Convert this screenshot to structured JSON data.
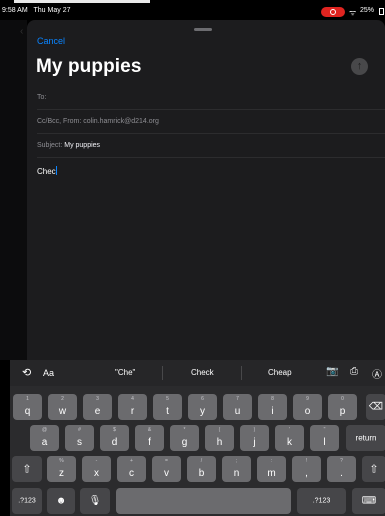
{
  "status": {
    "time": "9:58 AM",
    "date": "Thu May 27",
    "battery": "25%"
  },
  "compose": {
    "cancel_label": "Cancel",
    "title": "My puppies",
    "to_label": "To:",
    "ccbcc_label": "Cc/Bcc, From:",
    "from_value": "colin.hamrick@d214.org",
    "subject_label": "Subject:",
    "subject_value": "My puppies",
    "body_text": "Chec"
  },
  "suggestions": {
    "format_label": "Aa",
    "items": [
      "\"Che\"",
      "Check",
      "Cheap"
    ]
  },
  "keyboard": {
    "row1": [
      {
        "main": "q",
        "hint": "1"
      },
      {
        "main": "w",
        "hint": "2"
      },
      {
        "main": "e",
        "hint": "3"
      },
      {
        "main": "r",
        "hint": "4"
      },
      {
        "main": "t",
        "hint": "5"
      },
      {
        "main": "y",
        "hint": "6"
      },
      {
        "main": "u",
        "hint": "7"
      },
      {
        "main": "i",
        "hint": "8"
      },
      {
        "main": "o",
        "hint": "9"
      },
      {
        "main": "p",
        "hint": "0"
      }
    ],
    "row2": [
      {
        "main": "a",
        "hint": "@"
      },
      {
        "main": "s",
        "hint": "#"
      },
      {
        "main": "d",
        "hint": "$"
      },
      {
        "main": "f",
        "hint": "&"
      },
      {
        "main": "g",
        "hint": "*"
      },
      {
        "main": "h",
        "hint": "("
      },
      {
        "main": "j",
        "hint": ")"
      },
      {
        "main": "k",
        "hint": "'"
      },
      {
        "main": "l",
        "hint": "\""
      }
    ],
    "row3": [
      {
        "main": "z",
        "hint": "%"
      },
      {
        "main": "x",
        "hint": "-"
      },
      {
        "main": "c",
        "hint": "+"
      },
      {
        "main": "v",
        "hint": "="
      },
      {
        "main": "b",
        "hint": "/"
      },
      {
        "main": "n",
        "hint": ";"
      },
      {
        "main": "m",
        "hint": ":"
      },
      {
        "main": ",",
        "hint": "!"
      },
      {
        "main": ".",
        "hint": "?"
      }
    ],
    "return_label": "return",
    "numbers_left_label": ".?123",
    "numbers_right_label": ".?123"
  }
}
